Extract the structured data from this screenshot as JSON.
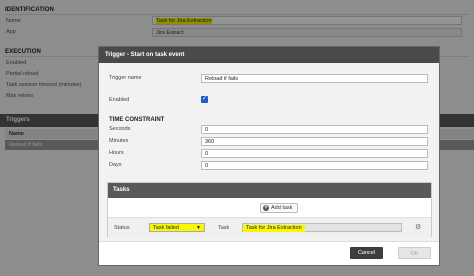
{
  "background": {
    "identification": {
      "title": "IDENTIFICATION",
      "name_label": "Name",
      "name_value": "Task for Jira Extraction",
      "app_label": "App",
      "app_value": "Jira Extract"
    },
    "execution": {
      "title": "EXECUTION",
      "enabled_label": "Enabled",
      "partial_reload_label": "Partial reload",
      "timeout_label": "Task session timeout (minutes)",
      "max_retries_label": "Max retries"
    },
    "triggers": {
      "title": "Triggers",
      "column_name": "Name",
      "rows": [
        {
          "name": "Reload if fails"
        }
      ]
    }
  },
  "dialog": {
    "title": "Trigger - Start on task event",
    "trigger_name_label": "Trigger name",
    "trigger_name_value": "Reload if fails",
    "enabled_label": "Enabled",
    "enabled_checked": true,
    "time_constraint": {
      "title": "TIME CONSTRAINT",
      "seconds_label": "Seconds",
      "seconds_value": "0",
      "minutes_label": "Minutes",
      "minutes_value": "360",
      "hours_label": "Hours",
      "hours_value": "0",
      "days_label": "Days",
      "days_value": "0"
    },
    "tasks": {
      "title": "Tasks",
      "add_task_label": "Add task",
      "row": {
        "status_label": "Status",
        "status_value": "Task failed",
        "task_label": "Task",
        "task_value": "Task for Jira Extraction"
      }
    },
    "cancel_label": "Cancel",
    "ok_label": "OK"
  },
  "colors": {
    "highlight": "#f8f800",
    "header_dark": "#4a4a4a",
    "checkbox_blue": "#1c5ebd"
  }
}
